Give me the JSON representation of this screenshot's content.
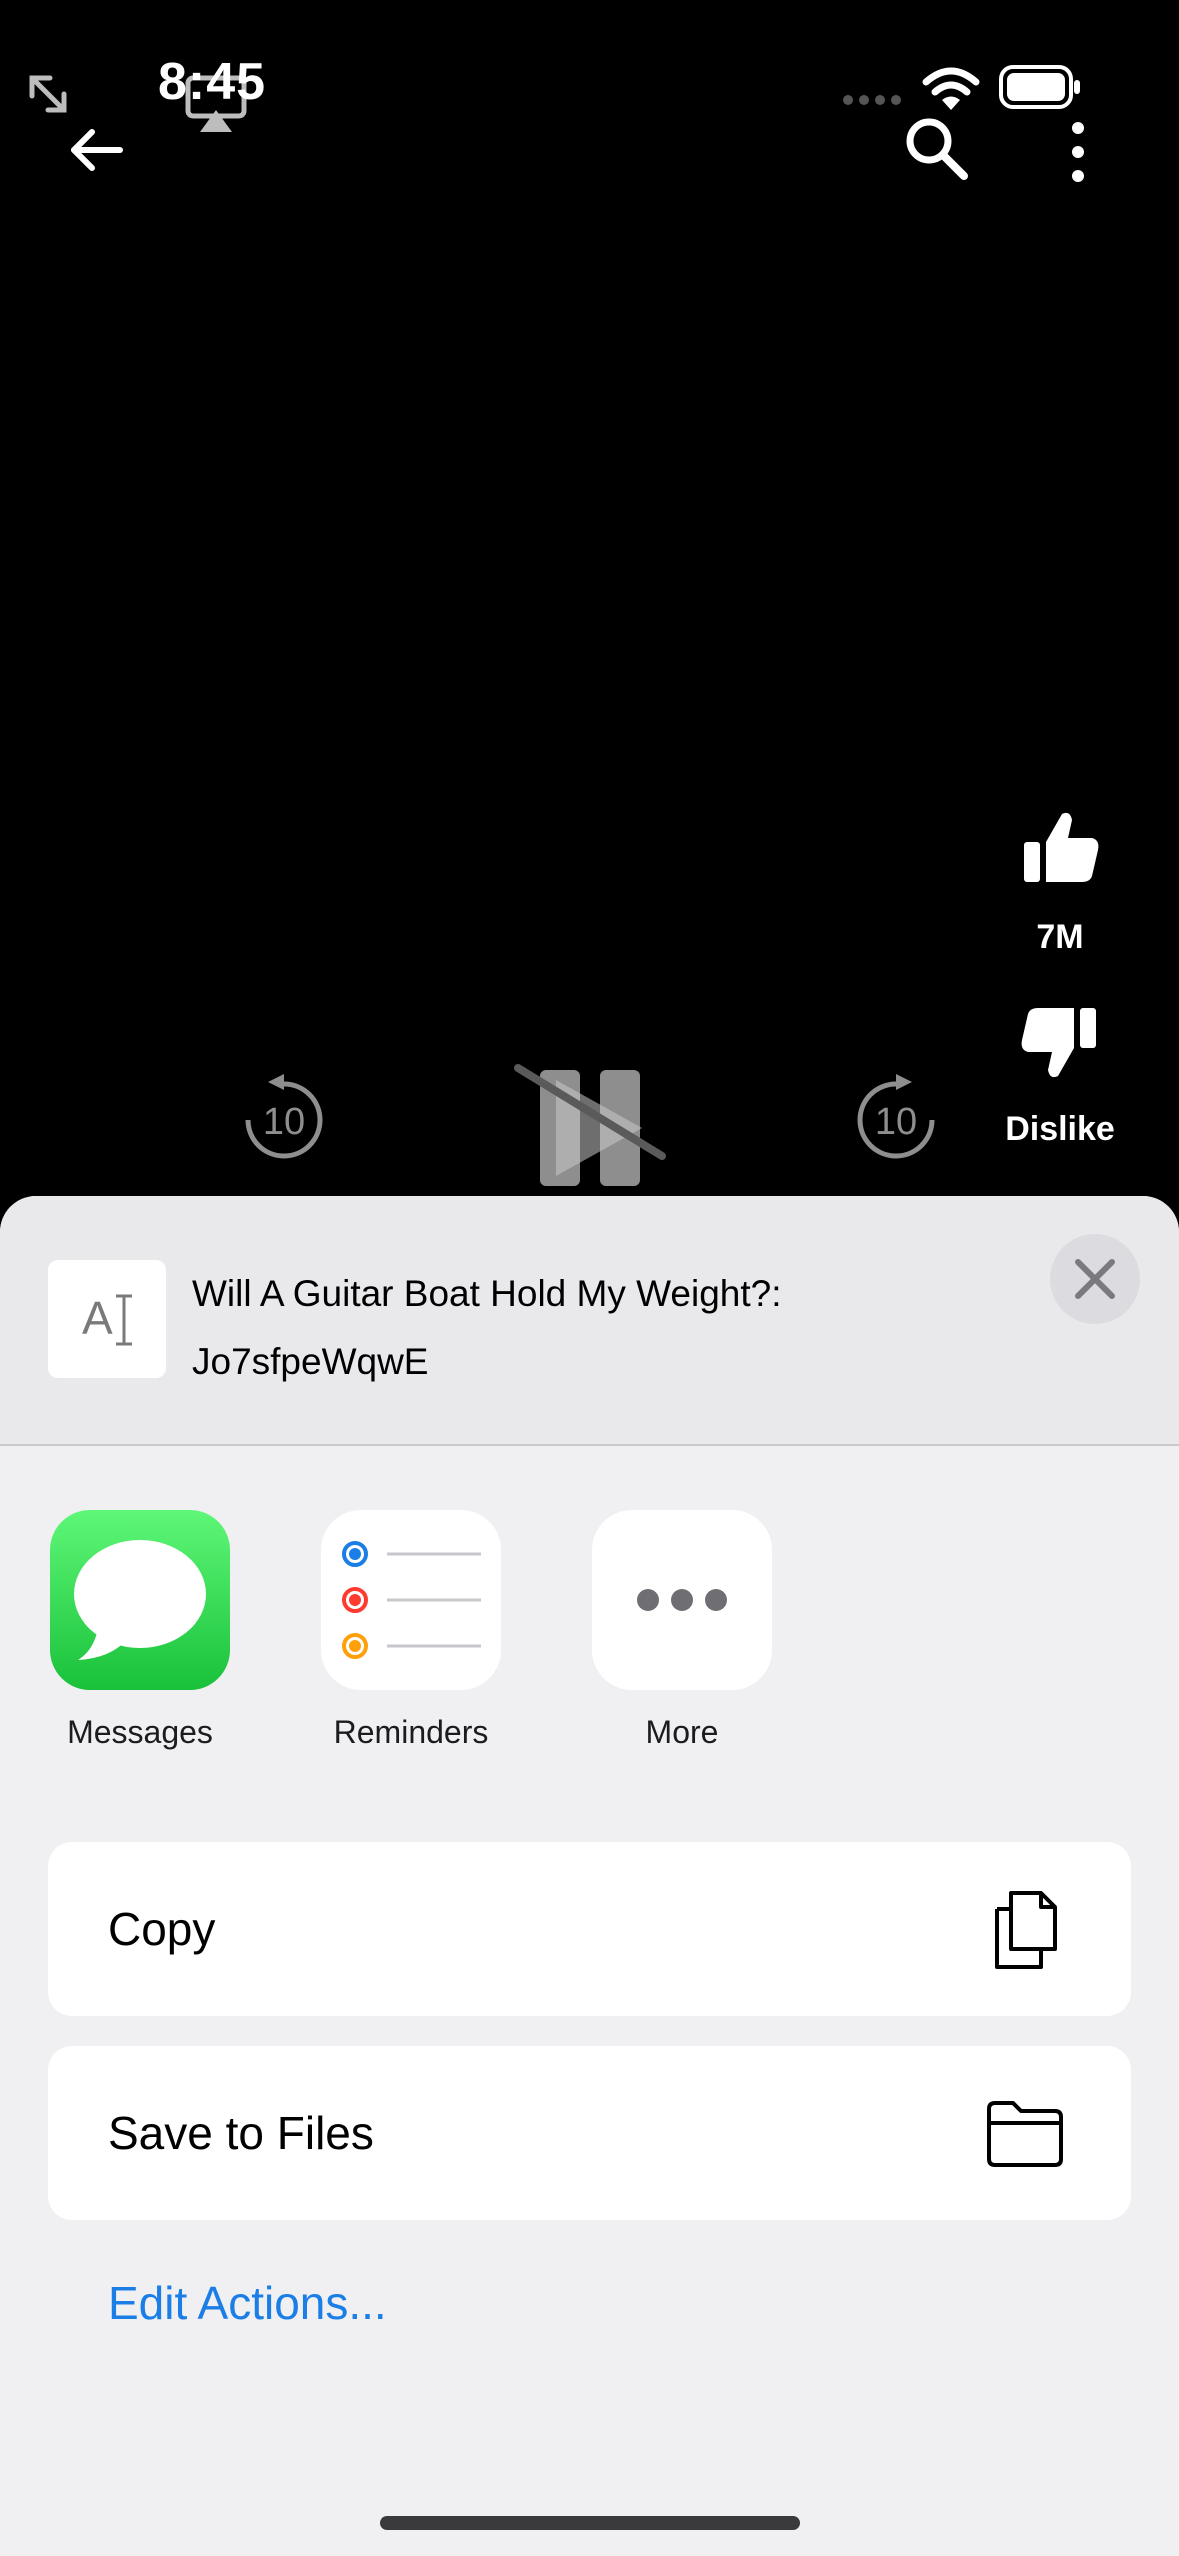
{
  "status_bar": {
    "time": "8:45"
  },
  "player": {
    "like_count": "7M",
    "dislike_label": "Dislike",
    "rewind_seconds": "10",
    "forward_seconds": "10"
  },
  "share_sheet": {
    "title_line1": "Will A Guitar Boat Hold My Weight?:",
    "title_line2": "Jo7sfpeWqwE",
    "apps": [
      {
        "label": "Messages",
        "icon": "messages-icon",
        "color": "#30d158"
      },
      {
        "label": "Reminders",
        "icon": "reminders-icon",
        "color": "#ffffff"
      },
      {
        "label": "More",
        "icon": "more-icon",
        "color": "#ffffff"
      }
    ],
    "actions": [
      {
        "label": "Copy",
        "icon": "copy-icon"
      },
      {
        "label": "Save to Files",
        "icon": "folder-icon"
      }
    ],
    "edit_actions_label": "Edit Actions..."
  },
  "colors": {
    "accent_blue": "#1a7ee6",
    "sheet_background": "#f0f0f2"
  }
}
